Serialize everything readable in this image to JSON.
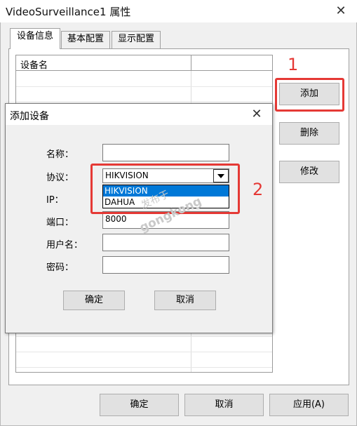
{
  "window": {
    "title": "VideoSurveillance1 属性",
    "close": "✕"
  },
  "tabs": [
    {
      "label": "设备信息"
    },
    {
      "label": "基本配置"
    },
    {
      "label": "显示配置"
    }
  ],
  "device_list": {
    "columns": [
      "设备名",
      ""
    ]
  },
  "side_buttons": {
    "add": "添加",
    "delete": "删除",
    "modify": "修改"
  },
  "annotations": {
    "step1": "1",
    "step2": "2",
    "color": "#e53935"
  },
  "footer_buttons": {
    "ok": "确定",
    "cancel": "取消",
    "apply": "应用(A)"
  },
  "dialog": {
    "title": "添加设备",
    "close": "✕",
    "fields": {
      "name_label": "名称：",
      "name_value": "",
      "protocol_label": "协议：",
      "protocol_value": "HIKVISION",
      "protocol_options": [
        "HIKVISION",
        "DAHUA"
      ],
      "protocol_selected_index": 0,
      "ip_label": "IP：",
      "port_label": "端口：",
      "port_value": "8000",
      "username_label": "用户名：",
      "username_value": "",
      "password_label": "密码：",
      "password_value": ""
    },
    "ok": "确定",
    "cancel": "取消"
  },
  "watermark": {
    "line1": "发布于",
    "line2": "gongkong"
  },
  "colors": {
    "selection": "#0078d7",
    "highlight": "#e53935"
  }
}
